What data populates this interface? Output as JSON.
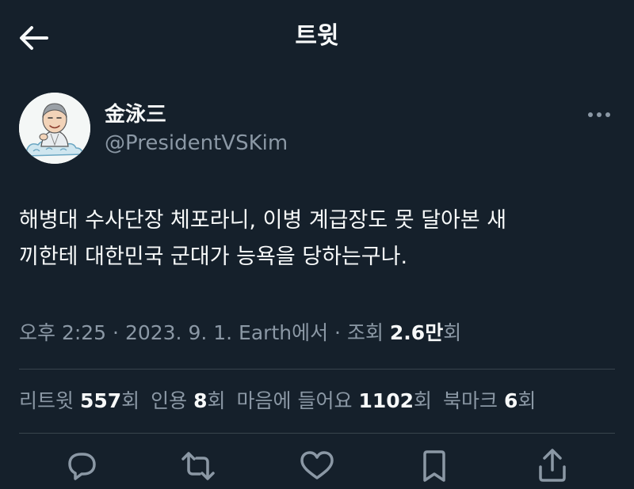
{
  "header": {
    "title": "트윗",
    "back_icon": "arrow-left-icon"
  },
  "author": {
    "display_name": "金泳三",
    "handle": "@PresidentVSKim",
    "avatar": "caricature-avatar"
  },
  "tweet": {
    "text": "해병대 수사단장 체포라니, 이병 계급장도 못 달아본 새\n끼한테 대한민국 군대가 능욕을 당하는구나."
  },
  "meta": {
    "time": "오후 2:25",
    "separator1": " · ",
    "date": "2023. 9. 1.",
    "via": " Earth에서",
    "separator2": " · ",
    "views_label": "조회 ",
    "views_value": "2.6만",
    "views_suffix": "회"
  },
  "stats": {
    "retweets_label": "리트윗 ",
    "retweets_value": "557",
    "retweets_suffix": "회",
    "quotes_label": "인용 ",
    "quotes_value": "8",
    "quotes_suffix": "회",
    "likes_label": "마음에 들어요 ",
    "likes_value": "1102",
    "likes_suffix": "회",
    "bookmarks_label": "북마크 ",
    "bookmarks_value": "6",
    "bookmarks_suffix": "회"
  },
  "actions": [
    {
      "icon": "reply-icon"
    },
    {
      "icon": "retweet-icon"
    },
    {
      "icon": "like-icon"
    },
    {
      "icon": "bookmark-icon"
    },
    {
      "icon": "share-icon"
    }
  ],
  "colors": {
    "background": "#15202b",
    "text": "#f7f9f9",
    "secondary_text": "#8b98a5",
    "divider": "#38444d"
  }
}
